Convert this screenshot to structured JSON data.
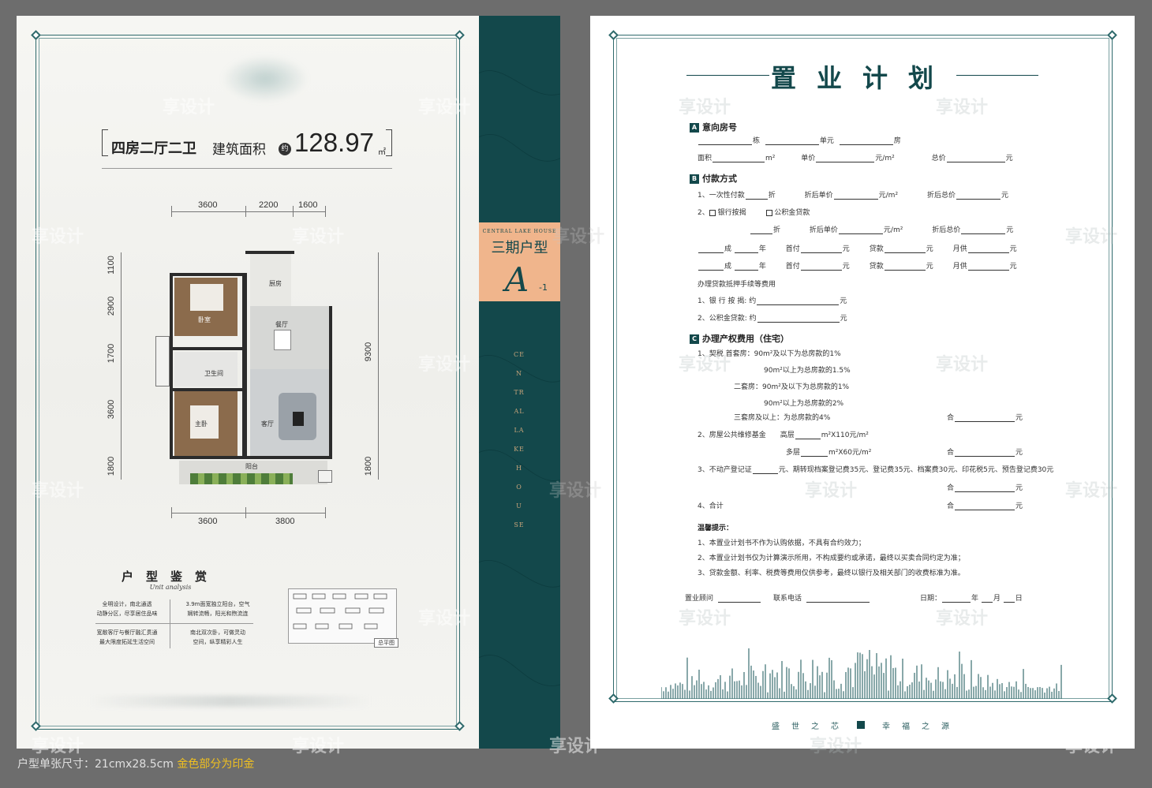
{
  "left_page": {
    "rooms": "四房二厅二卫",
    "area_label": "建筑面积",
    "approx": "约",
    "area_value": "128.97",
    "area_unit": "㎡",
    "dims_top": [
      "3600",
      "2200",
      "1600"
    ],
    "dims_bottom": [
      "3600",
      "3800"
    ],
    "dims_left": [
      "1100",
      "2900",
      "1700",
      "3600",
      "1800"
    ],
    "dims_right": [
      "9300",
      "1800"
    ],
    "room_labels": {
      "kitchen": "厨房",
      "bedroom": "卧室",
      "dining": "餐厅",
      "bath": "卫生间",
      "master": "主卧",
      "living": "客厅",
      "balcony": "阳台"
    },
    "analysis_title": "户型鉴赏",
    "analysis_sub": "Unit analysis",
    "analysis_items": [
      "全明设计，南北通透\n动静分区，尽享居住品味",
      "3.9m面宽独立阳台，空气\n娴转流畅，阳光和煦流连",
      "宽敞客厅与餐厅融汇贯通\n最大限度拓延生活空间",
      "南北双次卧，可做灵动\n空间，纵享精彩人生"
    ],
    "mini_map_tag": "总平图"
  },
  "spine": {
    "en": "CENTRAL LAKE HOUSE",
    "phase": "三期户型",
    "letter": "A",
    "number": "-1",
    "vertical": "CENTRALLAKEHOUSE"
  },
  "right_page": {
    "title": "置业计划",
    "sec_a": {
      "badge": "A",
      "label": "意向房号"
    },
    "a_line1": {
      "building": "栋",
      "unit": "单元",
      "room": "房"
    },
    "a_line2": {
      "area": "面积",
      "m2": "m²",
      "price": "单价",
      "price_unit": "元/m²",
      "total": "总价",
      "yuan": "元"
    },
    "sec_b": {
      "badge": "B",
      "label": "付款方式"
    },
    "b1": {
      "label": "1、一次性付款",
      "discount": "折",
      "disc_price": "折后单价",
      "price_unit": "元/m²",
      "disc_total": "折后总价",
      "yuan": "元"
    },
    "b2": {
      "label": "2、",
      "bank": "银行按揭",
      "fund": "公积金贷款"
    },
    "b3": {
      "discount": "折",
      "disc_price": "折后单价",
      "price_unit": "元/m²",
      "disc_total": "折后总价",
      "yuan": "元"
    },
    "b_row": {
      "cheng": "成",
      "year": "年",
      "down": "首付",
      "yuan": "元",
      "loan": "贷款",
      "monthly": "月供"
    },
    "b_fee_title": "办理贷款抵押手续等费用",
    "b_fee1": {
      "label": "1、银 行 按 揭: 约",
      "yuan": "元"
    },
    "b_fee2": {
      "label": "2、公积金贷款: 约",
      "yuan": "元"
    },
    "sec_c": {
      "badge": "C",
      "label": "办理产权费用（住宅）"
    },
    "c1": [
      "1、契税   首套房：90m²及以下为总房款的1%",
      "90m²以上为总房款的1.5%",
      "二套房：90m²及以下为总房款的1%",
      "90m²以上为总房款的2%",
      "三套房及以上：为总房款的4%"
    ],
    "he": "合",
    "yuan": "元",
    "c2": {
      "label": "2、房屋公共维修基金",
      "high": "高层",
      "high_unit": "m²X110元/m²",
      "multi": "多层",
      "multi_unit": "m²X60元/m²"
    },
    "c3": {
      "label": "3、不动产登记证",
      "rest": "元、期转现档案登记费35元、登记费35元、档案费30元、印花税5元、预告登记费30元"
    },
    "c4": "4、合计",
    "tips_title": "温馨提示：",
    "tips": [
      "1、本置业计划书不作为认购依据，不具有合约效力；",
      "2、本置业计划书仅为计算演示所用，不构成要约或承诺，最终以买卖合同约定为准；",
      "3、贷款金额、利率、税费等费用仅供参考，最终以银行及相关部门的收费标准为准。"
    ],
    "sign": {
      "consultant": "置业顾问",
      "phone": "联系电话",
      "date": "日期：",
      "year": "年",
      "month": "月",
      "day": "日"
    },
    "slogan_left": "盛世之芯",
    "slogan_right": "幸福之源"
  },
  "caption": {
    "text": "户型单张尺寸：21cmx28.5cm",
    "gold": "金色部分为印金"
  },
  "watermark": "享设计",
  "colors": {
    "teal": "#13484b",
    "peach": "#f0b58c",
    "gold": "#f0c020"
  }
}
